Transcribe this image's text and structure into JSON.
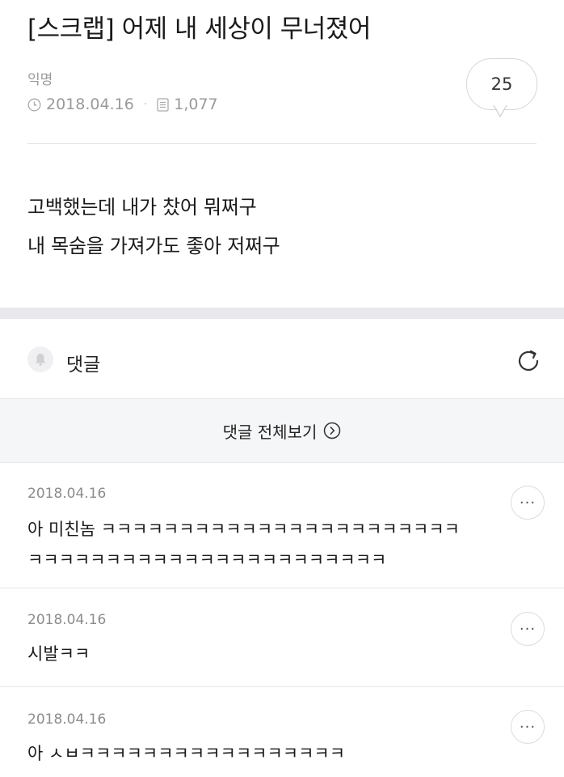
{
  "post": {
    "title": "[스크랩] 어제 내 세상이 무너졌어",
    "author": "익명",
    "date": "2018.04.16",
    "views": "1,077",
    "comment_count": "25",
    "body_lines": [
      "고백했는데 내가 찼어 뭐쩌구",
      "내 목숨을 가져가도 좋아 저쩌구"
    ]
  },
  "comments_section": {
    "label": "댓글",
    "view_all_label": "댓글 전체보기",
    "icons": {
      "bell": "bell-icon",
      "refresh": "refresh-icon",
      "view_all": "chevron-right-circle-icon",
      "more": "more-icon"
    }
  },
  "comments": [
    {
      "date": "2018.04.16",
      "lines": [
        "아 미친놈 ㅋㅋㅋㅋㅋㅋㅋㅋㅋㅋㅋㅋㅋㅋㅋㅋㅋㅋㅋㅋㅋㅋㅋ",
        "ㅋㅋㅋㅋㅋㅋㅋㅋㅋㅋㅋㅋㅋㅋㅋㅋㅋㅋㅋㅋㅋㅋㅋ"
      ]
    },
    {
      "date": "2018.04.16",
      "lines": [
        "시발ㅋㅋ"
      ]
    },
    {
      "date": "2018.04.16",
      "lines": [
        "아 ㅅㅂㅋㅋㅋㅋㅋㅋㅋㅋㅋㅋㅋㅋㅋㅋㅋㅋㅋ"
      ]
    }
  ],
  "colors": {
    "text": "#1a1a1a",
    "muted": "#9a9a9a",
    "band": "#e9e9ed",
    "view_all_bg": "#f5f6f8"
  }
}
